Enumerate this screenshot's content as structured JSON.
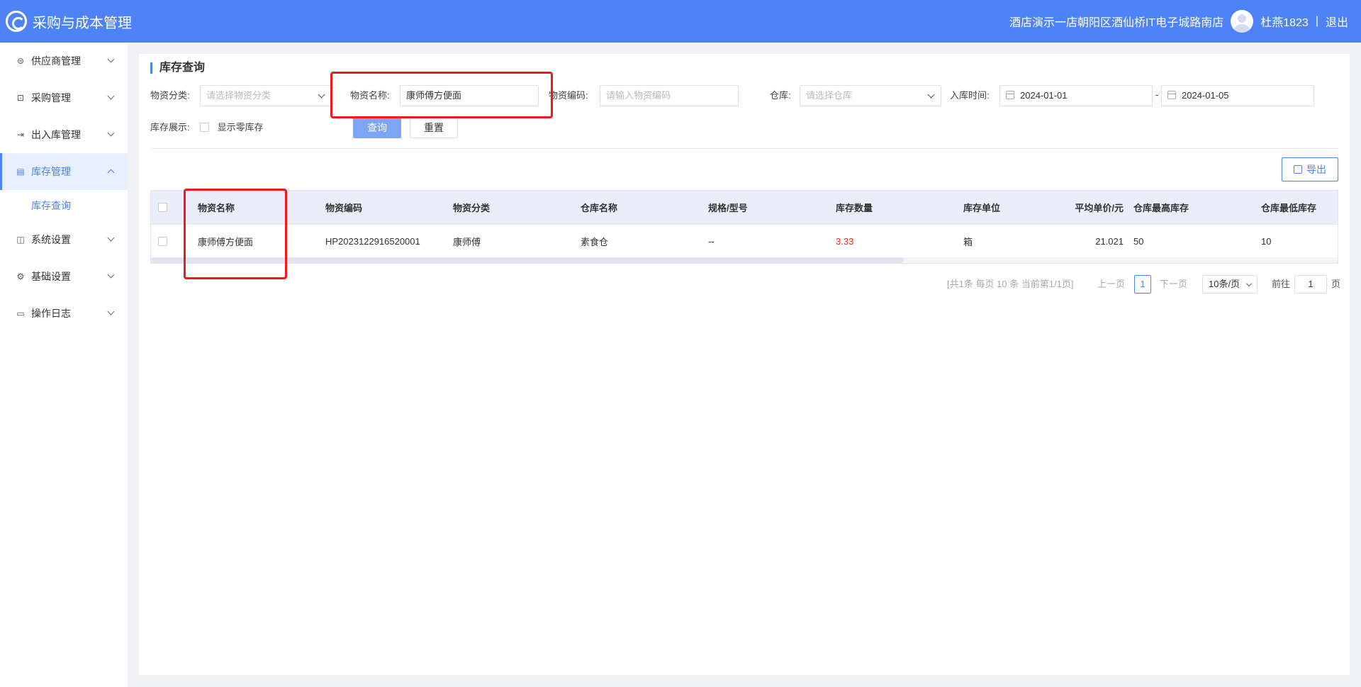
{
  "header": {
    "app_title": "采购与成本管理",
    "store": "酒店演示一店朝阳区酒仙桥IT电子城路南店",
    "user": "杜燕1823",
    "separator": "|",
    "logout": "退出"
  },
  "sidebar": {
    "items": [
      {
        "label": "供应商管理",
        "icon": "supplier-icon"
      },
      {
        "label": "采购管理",
        "icon": "purchase-icon"
      },
      {
        "label": "出入库管理",
        "icon": "inout-icon"
      },
      {
        "label": "库存管理",
        "icon": "inventory-icon"
      },
      {
        "label": "系统设置",
        "icon": "system-icon"
      },
      {
        "label": "基础设置",
        "icon": "gear-icon"
      },
      {
        "label": "操作日志",
        "icon": "log-icon"
      }
    ],
    "sub_item": "库存查询"
  },
  "page": {
    "title": "库存查询"
  },
  "filters": {
    "category_label": "物资分类:",
    "category_placeholder": "请选择物资分类",
    "name_label": "物资名称:",
    "name_value": "康师傅方便面",
    "code_label": "物资编码:",
    "code_placeholder": "请输入物资编码",
    "warehouse_label": "仓库:",
    "warehouse_placeholder": "请选择仓库",
    "time_label": "入库时间:",
    "date_from": "2024-01-01",
    "date_sep": "-",
    "date_to": "2024-01-05",
    "display_label": "库存展示:",
    "zero_stock_label": "显示零库存",
    "query_button": "查询",
    "reset_button": "重置"
  },
  "export_button": "导出",
  "table": {
    "columns": [
      "物资名称",
      "物资编码",
      "物资分类",
      "仓库名称",
      "规格/型号",
      "库存数量",
      "库存单位",
      "平均单价/元",
      "仓库最高库存",
      "仓库最低库存"
    ],
    "rows": [
      [
        "康师傅方便面",
        "HP2023122916520001",
        "康师傅",
        "素食仓",
        "--",
        "3.33",
        "箱",
        "21.021",
        "50",
        "10"
      ]
    ]
  },
  "pagination": {
    "summary": "[共1条 每页 10 条 当前第1/1页]",
    "prev": "上一页",
    "current": "1",
    "next": "下一页",
    "page_size": "10条/页",
    "goto_label": "前往",
    "goto_value": "1",
    "page_suffix": "页"
  },
  "colors": {
    "header": "#4e83f7",
    "highlight": "#f0191f",
    "accent": "#4e83f7"
  }
}
